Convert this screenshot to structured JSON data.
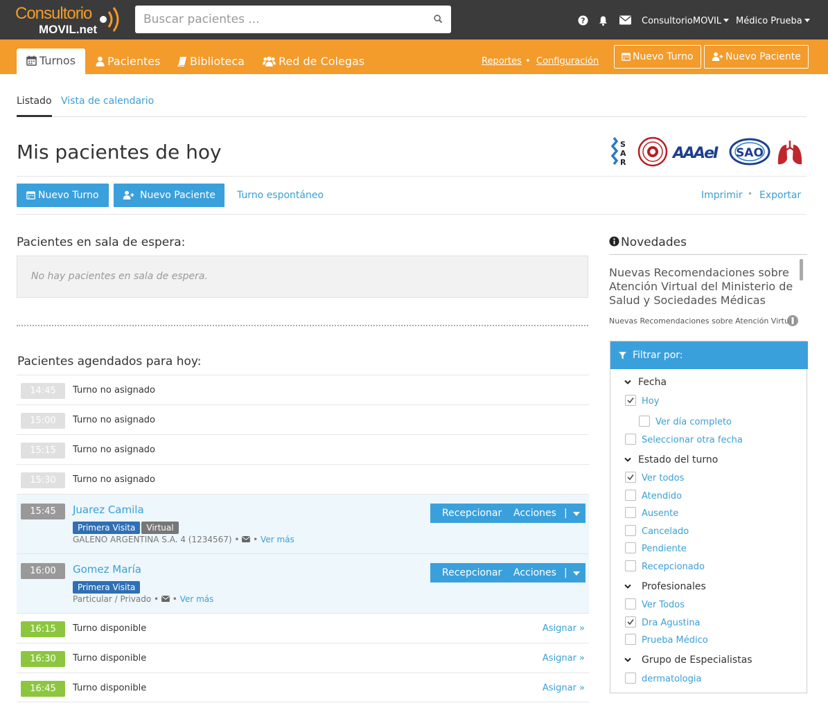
{
  "header": {
    "logo_line1": "Consultorio",
    "logo_line2": "MOVIL.net",
    "search_placeholder": "Buscar pacientes ...",
    "account_menu": "ConsultorioMOVIL",
    "user_menu": "Médico Prueba",
    "icons": [
      "help-icon",
      "bell-icon",
      "envelope-icon"
    ]
  },
  "nav": {
    "tabs": [
      {
        "label": "Turnos",
        "icon": "calendar-icon",
        "active": true
      },
      {
        "label": "Pacientes",
        "icon": "user-icon"
      },
      {
        "label": "Biblioteca",
        "icon": "book-icon"
      },
      {
        "label": "Red de Colegas",
        "icon": "users-icon"
      }
    ],
    "links": [
      "Reportes",
      "Configuración"
    ],
    "new_appointment": "Nuevo Turno",
    "new_patient": "Nuevo Paciente"
  },
  "subtabs": {
    "list": "Listado",
    "calendar": "Vista de calendario"
  },
  "page": {
    "title": "Mis pacientes de hoy",
    "btn_new_appointment": "Nuevo Turno",
    "btn_new_patient": "Nuevo Paciente",
    "spontaneous": "Turno espontáneo",
    "print": "Imprimir",
    "export": "Exportar"
  },
  "logos": [
    "SAR",
    "AAAeI",
    "SAO"
  ],
  "waiting": {
    "title": "Pacientes en sala de espera:",
    "empty": "No hay pacientes en sala de espera."
  },
  "schedule": {
    "title": "Pacientes agendados para hoy:",
    "rows": [
      {
        "time": "14:45",
        "text": "Turno no asignado"
      },
      {
        "time": "15:00",
        "text": "Turno no asignado"
      },
      {
        "time": "15:15",
        "text": "Turno no asignado"
      },
      {
        "time": "15:30",
        "text": "Turno no asignado"
      },
      {
        "time": "15:45",
        "name": "Juarez Camila",
        "badges": [
          "Primera Visita",
          "Virtual"
        ],
        "insurance": "GALENO ARGENTINA S.A. 4 (1234567)",
        "more": "Ver más",
        "receive": "Recepcionar",
        "actions": "Acciones"
      },
      {
        "time": "16:00",
        "name": "Gomez María",
        "badges": [
          "Primera Visita"
        ],
        "insurance": "Particular / Privado",
        "more": "Ver más",
        "receive": "Recepcionar",
        "actions": "Acciones"
      },
      {
        "time": "16:15",
        "text": "Turno disponible",
        "assign": "Asignar »"
      },
      {
        "time": "16:30",
        "text": "Turno disponible",
        "assign": "Asignar »"
      },
      {
        "time": "16:45",
        "text": "Turno disponible",
        "assign": "Asignar »"
      }
    ]
  },
  "news": {
    "title": "Novedades",
    "item_title": "Nuevas Recomendaciones sobre Atención Virtual del Ministerio de Salud y Sociedades Médicas",
    "item_sub": "Nuevas Recomendaciones sobre Atención Virtual"
  },
  "filter": {
    "title": "Filtrar por:",
    "fecha": {
      "label": "Fecha",
      "items": [
        {
          "label": "Hoy",
          "checked": true
        },
        {
          "label": "Ver día completo",
          "checked": false
        },
        {
          "label": "Seleccionar otra fecha",
          "checked": false
        }
      ]
    },
    "estado": {
      "label": "Estado del turno",
      "items": [
        {
          "label": "Ver todos",
          "checked": true
        },
        {
          "label": "Atendido"
        },
        {
          "label": "Ausente"
        },
        {
          "label": "Cancelado"
        },
        {
          "label": "Pendiente"
        },
        {
          "label": "Recepcionado"
        }
      ]
    },
    "profesionales": {
      "label": "Profesionales",
      "items": [
        {
          "label": "Ver Todos"
        },
        {
          "label": "Dra Agustina",
          "checked": true
        },
        {
          "label": "Prueba Médico"
        }
      ]
    },
    "grupo": {
      "label": "Grupo de Especialistas",
      "items": [
        {
          "label": "dermatologia"
        }
      ]
    }
  },
  "colors": {
    "orange": "#f39b2b",
    "blue": "#3aa0dc",
    "dark": "#3b3b3b",
    "green": "#8cc63f"
  }
}
